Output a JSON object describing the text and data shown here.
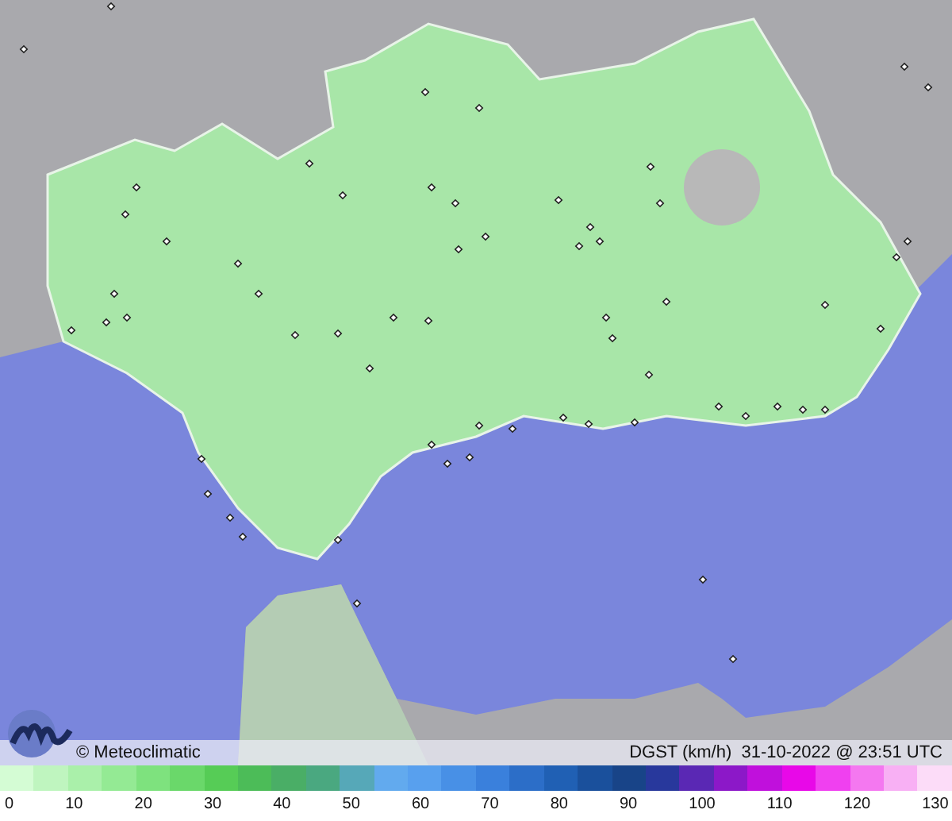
{
  "credit": "© Meteoclimatic",
  "caption": "DGST (km/h)  31-10-2022 @ 23:51 UTC",
  "scale": {
    "swatches": [
      {
        "color": "#d4fcd4"
      },
      {
        "color": "#bff5bf"
      },
      {
        "color": "#aaf0aa"
      },
      {
        "color": "#94ea94"
      },
      {
        "color": "#7ee27e"
      },
      {
        "color": "#6ad86a"
      },
      {
        "color": "#56cc56"
      },
      {
        "color": "#4cbc58"
      },
      {
        "color": "#4aae66"
      },
      {
        "color": "#4aa880"
      },
      {
        "color": "#56a8b8"
      },
      {
        "color": "#62aaee"
      },
      {
        "color": "#58a0ee"
      },
      {
        "color": "#4890e6"
      },
      {
        "color": "#3a80dc"
      },
      {
        "color": "#2c6ec8"
      },
      {
        "color": "#2060b4"
      },
      {
        "color": "#1a509c"
      },
      {
        "color": "#184488"
      },
      {
        "color": "#28389c"
      },
      {
        "color": "#5a28b4"
      },
      {
        "color": "#8c18c8"
      },
      {
        "color": "#c010dc"
      },
      {
        "color": "#e808e8"
      },
      {
        "color": "#f040f0"
      },
      {
        "color": "#f478f0"
      },
      {
        "color": "#f8b0f4"
      },
      {
        "color": "#fcdcf8"
      }
    ],
    "labels": [
      "0",
      "10",
      "20",
      "30",
      "40",
      "50",
      "60",
      "70",
      "80",
      "90",
      "100",
      "110",
      "120",
      "130"
    ]
  }
}
